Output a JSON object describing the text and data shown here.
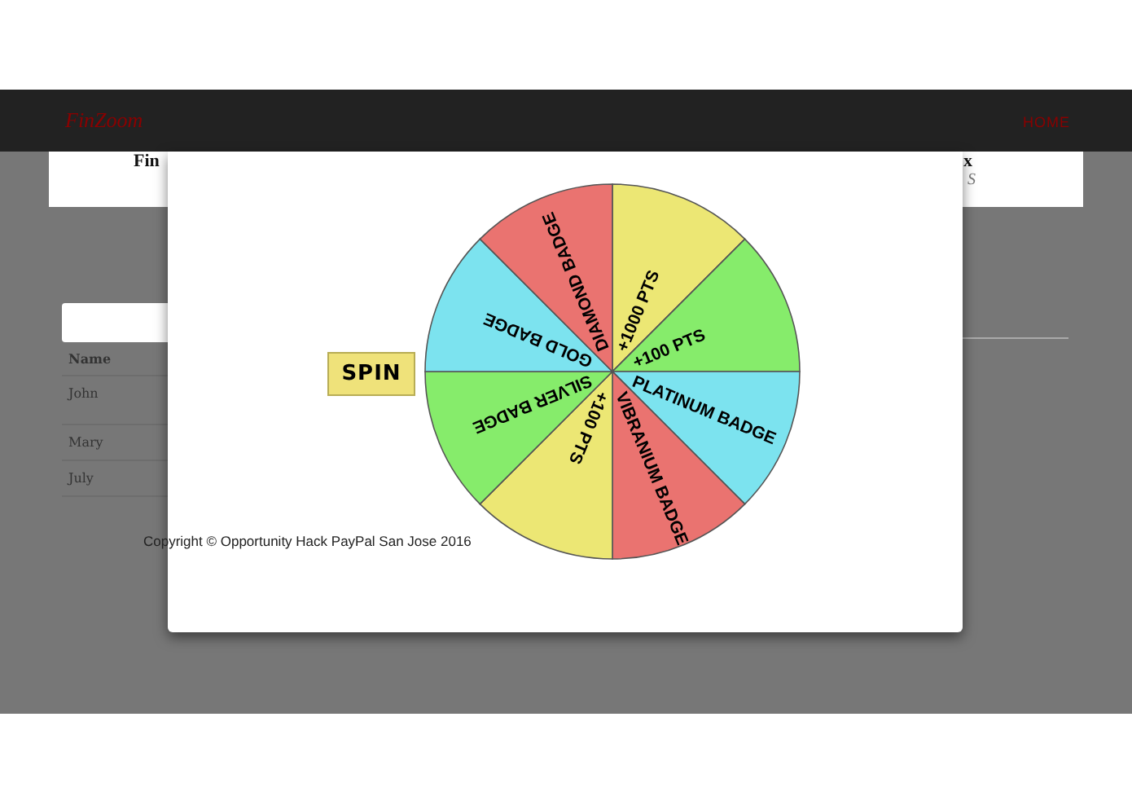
{
  "navbar": {
    "brand": "FinZoom",
    "links": [
      {
        "label": "HOME"
      }
    ]
  },
  "background_card": {
    "title_left": "Fin",
    "title_right": "x",
    "subtitle_right": "S"
  },
  "table": {
    "columns": [
      "Name"
    ],
    "rows": [
      [
        "John"
      ],
      [
        "Mary"
      ],
      [
        "July"
      ]
    ]
  },
  "modal": {
    "spin_button": "SPIN",
    "wheel": {
      "segments": [
        {
          "label": "+1000 PTS",
          "color": "#ece774"
        },
        {
          "label": "+100 PTS",
          "color": "#86ec6b"
        },
        {
          "label": "PLATINUM BADGE",
          "color": "#7ce3ef"
        },
        {
          "label": "VIBRANIUM BADGE",
          "color": "#ea7370"
        },
        {
          "label": "+100 PTS",
          "color": "#ece774"
        },
        {
          "label": "SILVER BADGE",
          "color": "#86ec6b"
        },
        {
          "label": "GOLD BADGE",
          "color": "#7ce3ef"
        },
        {
          "label": "DIAMOND BADGE",
          "color": "#ea7370"
        }
      ]
    }
  },
  "footer": {
    "copyright": "Copyright © Opportunity Hack PayPal San Jose 2016"
  }
}
